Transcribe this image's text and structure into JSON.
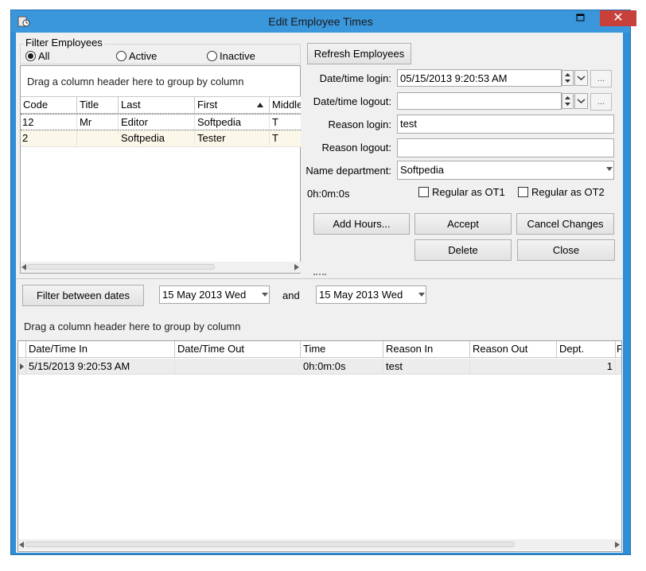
{
  "window": {
    "title": "Edit Employee Times",
    "close_glyph": "✕",
    "restore_glyph": "❐"
  },
  "filter": {
    "legend": "Filter Employees",
    "options": [
      "All",
      "Active",
      "Inactive"
    ],
    "selected": "All"
  },
  "employees_grid": {
    "drag_hint": "Drag a column header here to group by column",
    "columns": [
      "Code",
      "Title",
      "Last",
      "First",
      "Middle"
    ],
    "sorted_column": "First",
    "rows": [
      [
        "12",
        "Mr",
        "Editor",
        "Softpedia",
        "T"
      ],
      [
        "2",
        "",
        "Softpedia",
        "Tester",
        "T"
      ]
    ]
  },
  "form": {
    "refresh_label": "Refresh Employees",
    "login_label": "Date/time login:",
    "login_value": "05/15/2013 9:20:53 AM",
    "logout_label": "Date/time logout:",
    "logout_value": "",
    "reason_login_label": "Reason login:",
    "reason_login_value": "test",
    "reason_logout_label": "Reason logout:",
    "reason_logout_value": "",
    "department_label": "Name department:",
    "department_value": "Softpedia",
    "duration": "0h:0m:0s",
    "ot1_label": "Regular as OT1",
    "ot2_label": "Regular as OT2",
    "ellipsis": "..."
  },
  "actions": {
    "add_hours": "Add Hours...",
    "accept": "Accept",
    "cancel_changes": "Cancel Changes",
    "delete": "Delete",
    "close": "Close"
  },
  "dates": {
    "filter_button": "Filter between dates",
    "from": "15 May 2013 Wed",
    "and_label": "and",
    "to": "15 May 2013 Wed"
  },
  "times_grid": {
    "drag_hint": "Drag a column header here to group by column",
    "columns": [
      "Date/Time In",
      "Date/Time Out",
      "Time",
      "Reason In",
      "Reason Out",
      "Dept.",
      "F"
    ],
    "rows": [
      [
        "5/15/2013 9:20:53 AM",
        "",
        "0h:0m:0s",
        "test",
        "",
        "1",
        ""
      ]
    ]
  },
  "colors": {
    "titlebar": "#3b97dc",
    "close_button": "#c7403a",
    "client": "#f0f0f0"
  }
}
